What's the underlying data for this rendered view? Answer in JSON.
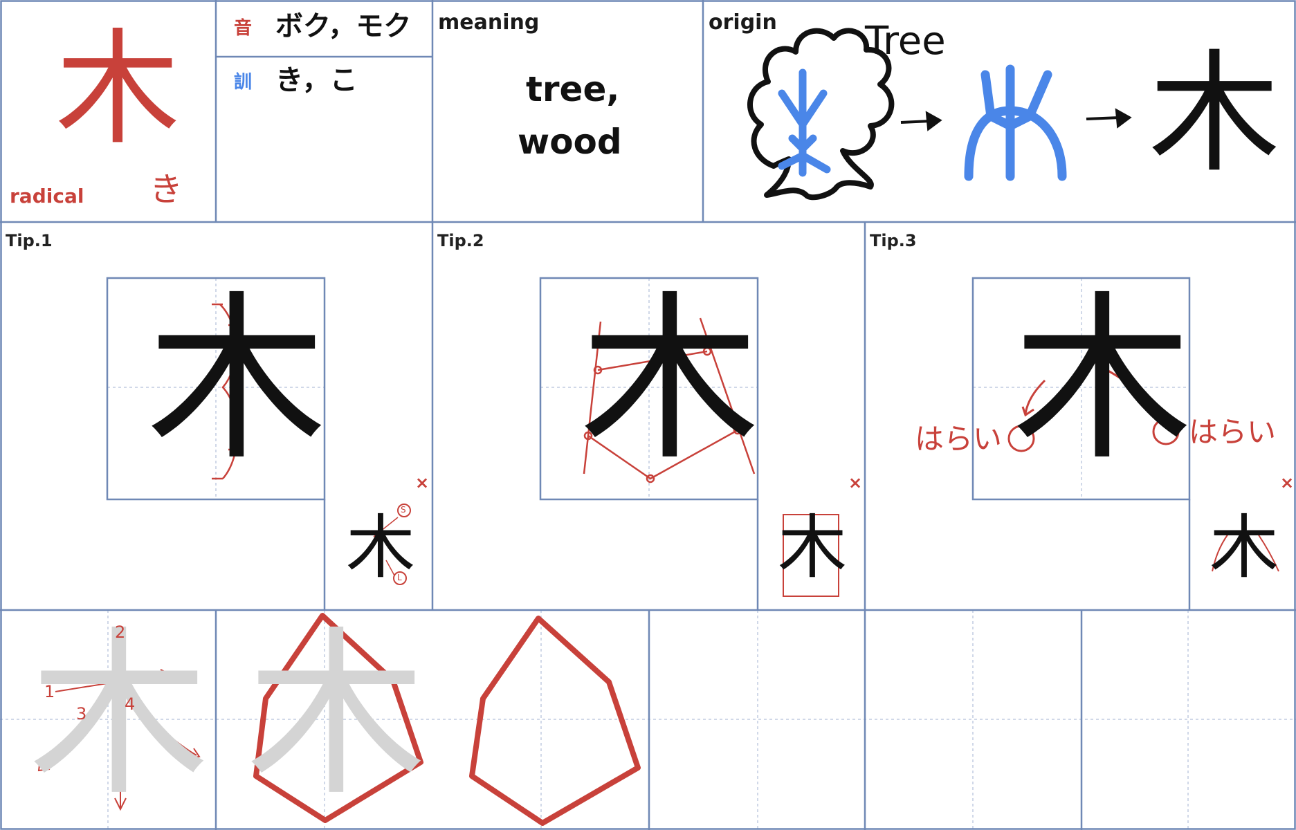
{
  "kanji": "木",
  "radical": {
    "label": "radical",
    "reading": "き"
  },
  "on_reading": {
    "label": "音",
    "value": "ボク，モク"
  },
  "kun_reading": {
    "label": "訓",
    "value": "き，こ"
  },
  "meaning": {
    "label": "meaning",
    "line1": "tree,",
    "line2": "wood"
  },
  "origin": {
    "label": "origin",
    "caption": "Tree"
  },
  "tips": [
    {
      "label": "Tip.1",
      "close": "×",
      "mark_s": "S",
      "mark_l": "L"
    },
    {
      "label": "Tip.2",
      "close": "×"
    },
    {
      "label": "Tip.3",
      "close": "×",
      "harai_left": "はらい",
      "harai_right": "はらい"
    }
  ],
  "stroke_order": [
    "1",
    "2",
    "3",
    "4"
  ],
  "colors": {
    "grid_blue": "#6f88b5",
    "guide": "#c0cce0",
    "accent_red": "#c8413a",
    "origin_blue": "#4a86e8",
    "trace_gray": "#d4d4d4"
  }
}
